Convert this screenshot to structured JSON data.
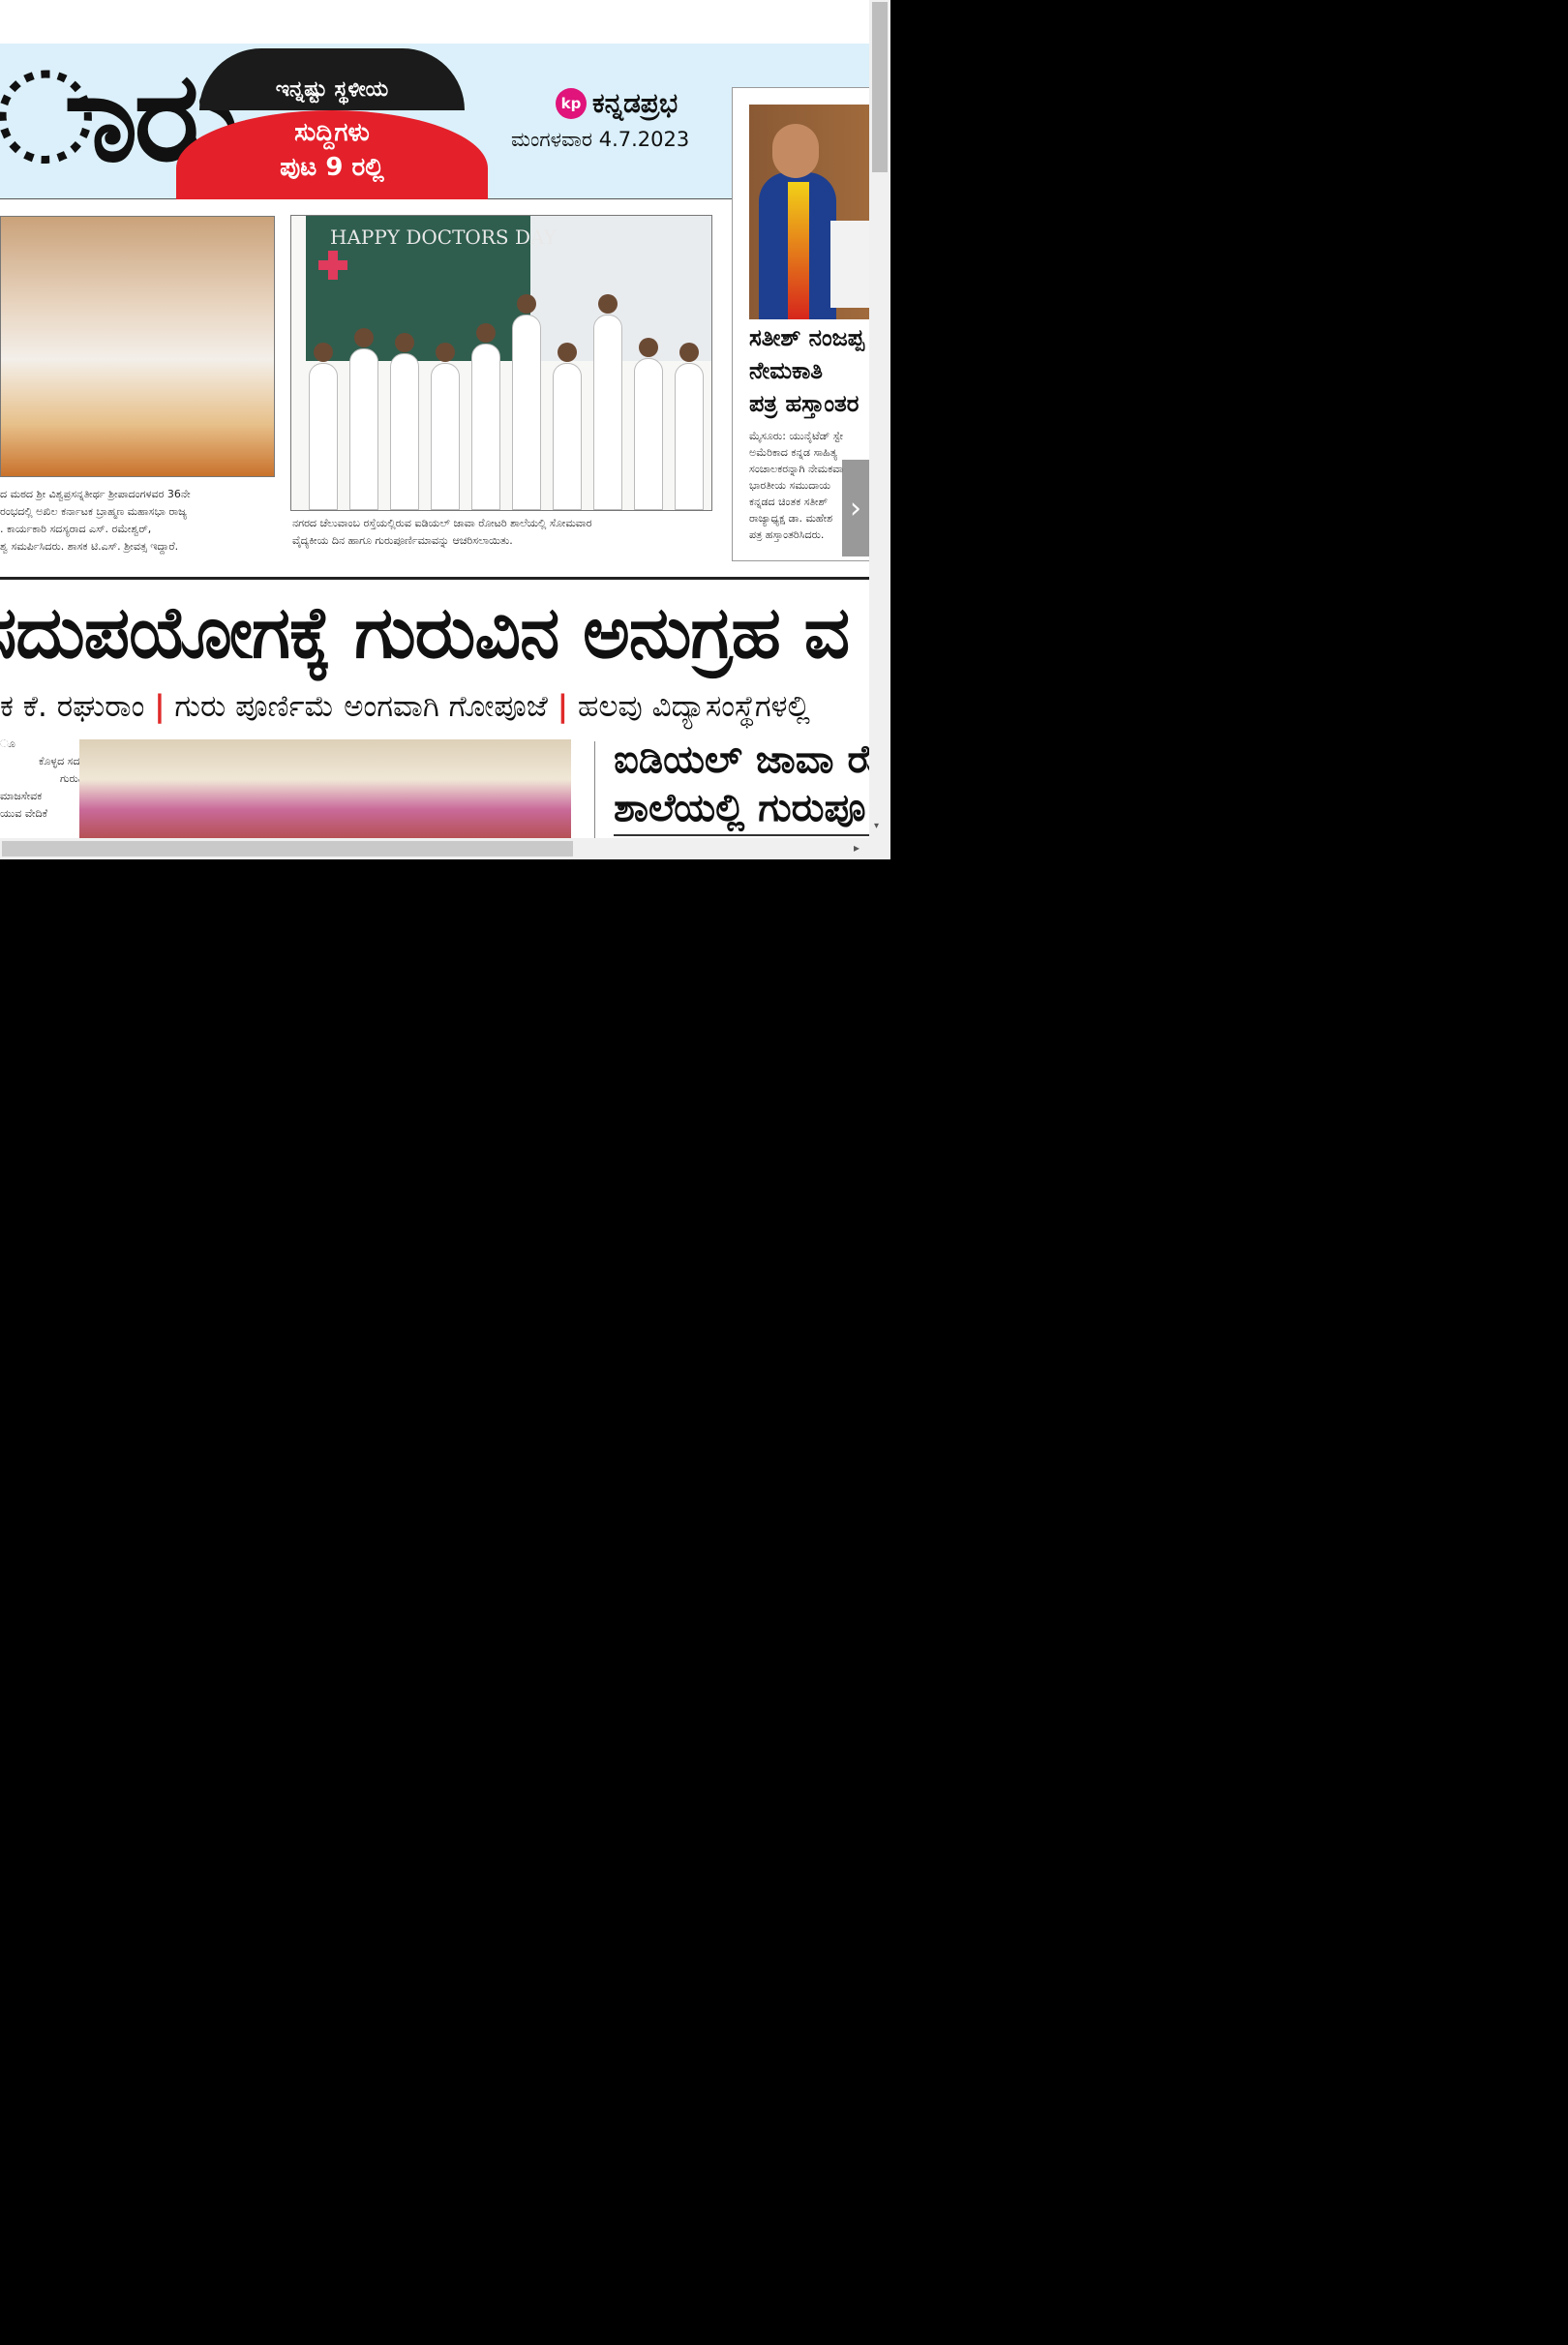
{
  "masthead": {
    "big_word": "ಾರು",
    "badge_line1": "ಇನ್ನಷ್ಟು ಸ್ಥಳೀಯ",
    "badge_line2": "ಸುದ್ದಿಗಳು",
    "badge_line3": "ಪುಟ 9 ರಲ್ಲಿ",
    "brand_logo": "kp",
    "brand_name": "ಕನ್ನಡಪ್ರಭ",
    "date": "ಮಂಗಳವಾರ 4.7.2023"
  },
  "photo2": {
    "board_text": "HAPPY DOCTORS DAY"
  },
  "captions": {
    "photo1_lines": [
      "ದ ಮಠದ ಶ್ರೀ ವಿಶ್ವಪ್ರಸನ್ನತೀರ್ಥ ಶ್ರೀಪಾದಂಗಳವರ 36ನೇ",
      "ರಂಭದಲ್ಲಿ ಅಖಿಲ ಕರ್ನಾಟಕ ಬ್ರಾಹ್ಮಣ ಮಹಾಸಭಾ ರಾಜ್ಯ",
      ". ಕಾರ್ಯಕಾರಿ ಸದಸ್ಯರಾದ ಎಸ್. ರಮೇಶ್ವರ್,",
      "ಶ್ವ ಸಮರ್ಪಿಸಿದರು. ಶಾಸಕ ಟಿ.ಎಸ್. ಶ್ರೀವತ್ಸ ಇದ್ದಾರೆ."
    ],
    "photo2_lines": [
      "ನಗರದ ಚೆಲುವಾಂಬ ರಸ್ತೆಯಲ್ಲಿರುವ ಐಡಿಯಲ್ ಜಾವಾ ರೋಟರಿ ಶಾಲೆಯಲ್ಲಿ ಸೋಮವಾರ",
      "ವೈದ್ಯಕೀಯ ದಿನ ಹಾಗೂ ಗುರುಪೂರ್ಣಿಮಾವನ್ನು ಆಚರಿಸಲಾಯಿತು."
    ]
  },
  "sidebar": {
    "headline_lines": [
      "ಸತೀಶ್ ನಂಜಪ್ಪ",
      "ನೇಮಕಾತಿ",
      "ಪತ್ರ ಹಸ್ತಾಂತರ"
    ],
    "body_lines": [
      "ಮೈಸೂರು: ಯುನೈಟೆಡ್ ಸ್ಟೇ",
      "ಅಮೆರಿಕಾದ ಕನ್ನಡ ಸಾಹಿತ್ಯ",
      "ಸಂಚಾಲಕರನ್ನಾಗಿ ನೇಮಕವಾ",
      "ಭಾರತೀಯ ಸಮುದಾಯ",
      "ಕನ್ನಡದ ಚಿಂತಕ ಸತೀಶ್",
      "ರಾಜ್ಯಾಧ್ಯಕ್ಷ ಡಾ. ಮಹೇಶ",
      "ಪತ್ರ ಹಸ್ತಾಂತರಿಸಿದರು."
    ]
  },
  "main_story": {
    "headline": "ಸದುಪಯೋಗಕ್ಕೆ ಗುರುವಿನ ಅನುಗ್ರಹ ವ",
    "sub_part1": "ಕ ಕೆ. ರಘುರಾಂ",
    "sub_sep": "|",
    "sub_part2": "ಗುರು ಪೂರ್ಣಿಮೆ ಅಂಗವಾಗಿ ಗೋಪೂಜೆ",
    "sub_part3": "ಹಲವು ವಿದ್ಯಾಸಂಸ್ಥೆಗಳಲ್ಲಿ",
    "left_col_lines": [
      "ೂ",
      "ಕೊಳ್ಳದ ಸದು",
      "ಗುರುವಿನ",
      "ಮಾಜಸೇವಕ",
      "",
      "ಯುವ ವೇದಿಕೆ"
    ],
    "right_headline_line1": "ಐಡಿಯಲ್ ಜಾವಾ ರೋ",
    "right_headline_line2": "ಶಾಲೆಯಲ್ಲಿ ಗುರುಪೂ"
  },
  "viewer": {
    "next_arrow": "›",
    "scroll_up_arrow": "▾",
    "scroll_right_arrow": "▸"
  },
  "colors": {
    "band": "#dbf0fa",
    "badge_red": "#e4202a",
    "brand_pink": "#e0147a",
    "separator_red": "#e02a2a"
  }
}
